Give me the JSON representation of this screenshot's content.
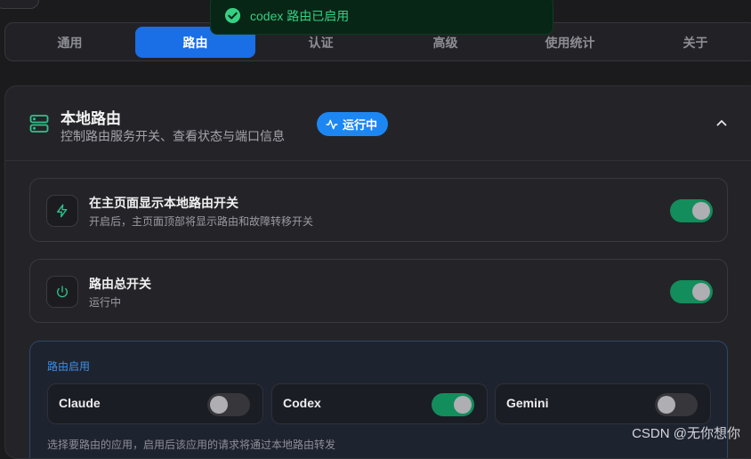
{
  "toast": {
    "text": "codex 路由已启用",
    "icon": "check-circle-icon",
    "color": "#36d083"
  },
  "tabs": [
    {
      "label": "通用",
      "active": false
    },
    {
      "label": "路由",
      "active": true
    },
    {
      "label": "认证",
      "active": false
    },
    {
      "label": "高级",
      "active": false
    },
    {
      "label": "使用统计",
      "active": false
    },
    {
      "label": "关于",
      "active": false
    }
  ],
  "section": {
    "title": "本地路由",
    "subtitle": "控制路由服务开关、查看状态与端口信息",
    "badge": "运行中",
    "icon": "server-icon"
  },
  "cards": [
    {
      "title": "在主页面显示本地路由开关",
      "subtitle": "开启后，主页面顶部将显示路由和故障转移开关",
      "icon": "lightning-icon",
      "enabled": true
    },
    {
      "title": "路由总开关",
      "subtitle": "运行中",
      "icon": "power-icon",
      "enabled": true
    }
  ],
  "routing": {
    "label": "路由启用",
    "apps": [
      {
        "name": "Claude",
        "enabled": false
      },
      {
        "name": "Codex",
        "enabled": true
      },
      {
        "name": "Gemini",
        "enabled": false
      }
    ],
    "hint": "选择要路由的应用，启用后该应用的请求将通过本地路由转发"
  },
  "watermark": "CSDN @无你想你",
  "colors": {
    "accent": "#1a6ee6",
    "toggle_on": "#138d5b",
    "success": "#36d083",
    "badge": "#1c87f3"
  }
}
